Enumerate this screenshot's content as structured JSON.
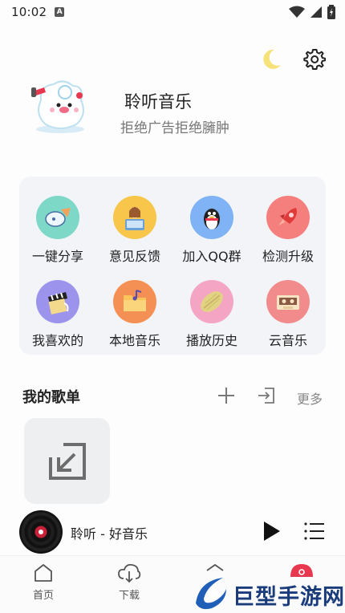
{
  "status_bar": {
    "time": "10:02",
    "a_badge": "A"
  },
  "profile": {
    "app_name": "聆听音乐",
    "slogan": "拒绝广告拒绝臃肿"
  },
  "grid": [
    {
      "label": "一键分享",
      "icon": "share-icon",
      "color": "#7dd8c8"
    },
    {
      "label": "意见反馈",
      "icon": "feedback-icon",
      "color": "#f7c64a"
    },
    {
      "label": "加入QQ群",
      "icon": "qq-penguin-icon",
      "color": "#7fb3f5"
    },
    {
      "label": "检测升级",
      "icon": "rocket-icon",
      "color": "#f47f7c"
    },
    {
      "label": "我喜欢的",
      "icon": "favorite-icon",
      "color": "#9b93ec"
    },
    {
      "label": "本地音乐",
      "icon": "folder-music-icon",
      "color": "#f59055"
    },
    {
      "label": "播放历史",
      "icon": "history-icon",
      "color": "#f4a5c4"
    },
    {
      "label": "云音乐",
      "icon": "cassette-icon",
      "color": "#f28b8b"
    }
  ],
  "playlists": {
    "title": "我的歌单",
    "more": "更多"
  },
  "player": {
    "now_playing": "聆听 - 好音乐"
  },
  "nav": {
    "home": "首页",
    "download": "下载"
  },
  "watermark": {
    "text": "巨型手游网"
  },
  "colors": {
    "accent": "#e8384f",
    "card_bg": "#f3f4f8",
    "moon": "#f7e27a"
  }
}
